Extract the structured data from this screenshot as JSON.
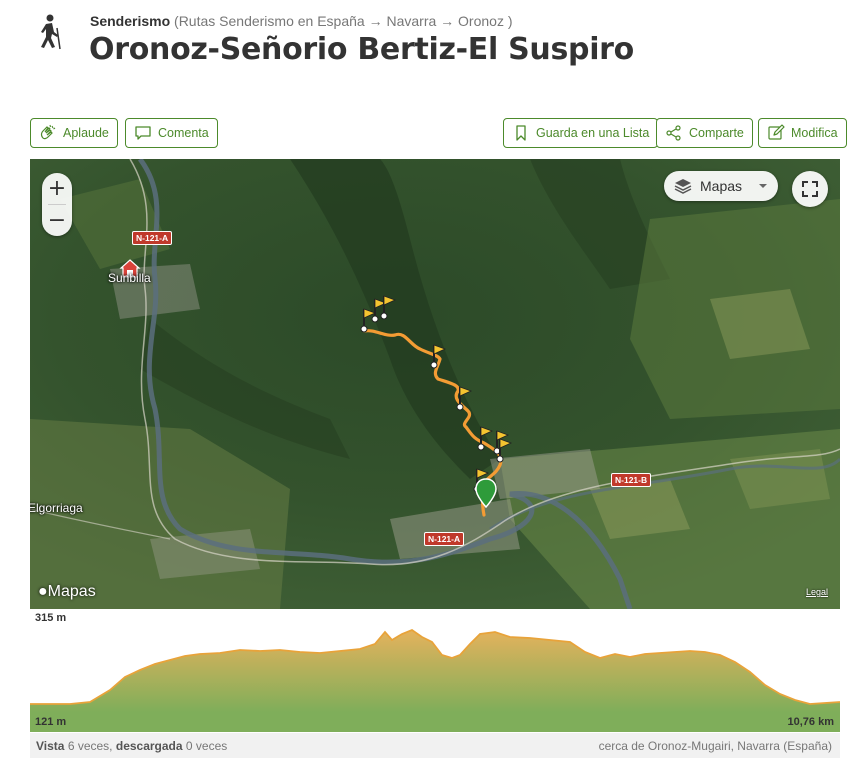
{
  "header": {
    "activity_icon": "hiker-icon",
    "category": "Senderismo",
    "breadcrumb": "(Rutas Senderismo en España → Navarra → Oronoz )",
    "title": "Oronoz-Señorio Bertiz-El Suspiro"
  },
  "actions": {
    "applaud": "Aplaude",
    "comment": "Comenta",
    "save_list": "Guarda en una Lista",
    "share": "Comparte",
    "edit": "Modifica"
  },
  "map": {
    "zoom_in": "+",
    "zoom_out": "−",
    "map_type": "Mapas",
    "attribution": "Mapas",
    "legal": "Legal",
    "towns": [
      "Sunbilla",
      "Elgorriaga"
    ],
    "roads": [
      "N-121-A",
      "N-121-B",
      "N-121-A"
    ],
    "colors": {
      "track": "#f39c34",
      "start_marker": "#2e9b3a",
      "road_badge": "#c0392b"
    }
  },
  "profile": {
    "max_elevation": "315 m",
    "min_elevation": "121 m",
    "distance": "10,76 km",
    "colors": {
      "line": "#e8a33a",
      "fill_top": "#e5b25c",
      "fill_bottom": "#7fae5a"
    }
  },
  "stats": {
    "views_label": "Vista",
    "views_value": "6 veces,",
    "downloads_label": "descargada",
    "downloads_value": "0 veces",
    "location": "cerca de Oronoz-Mugairi, Navarra (España)"
  }
}
